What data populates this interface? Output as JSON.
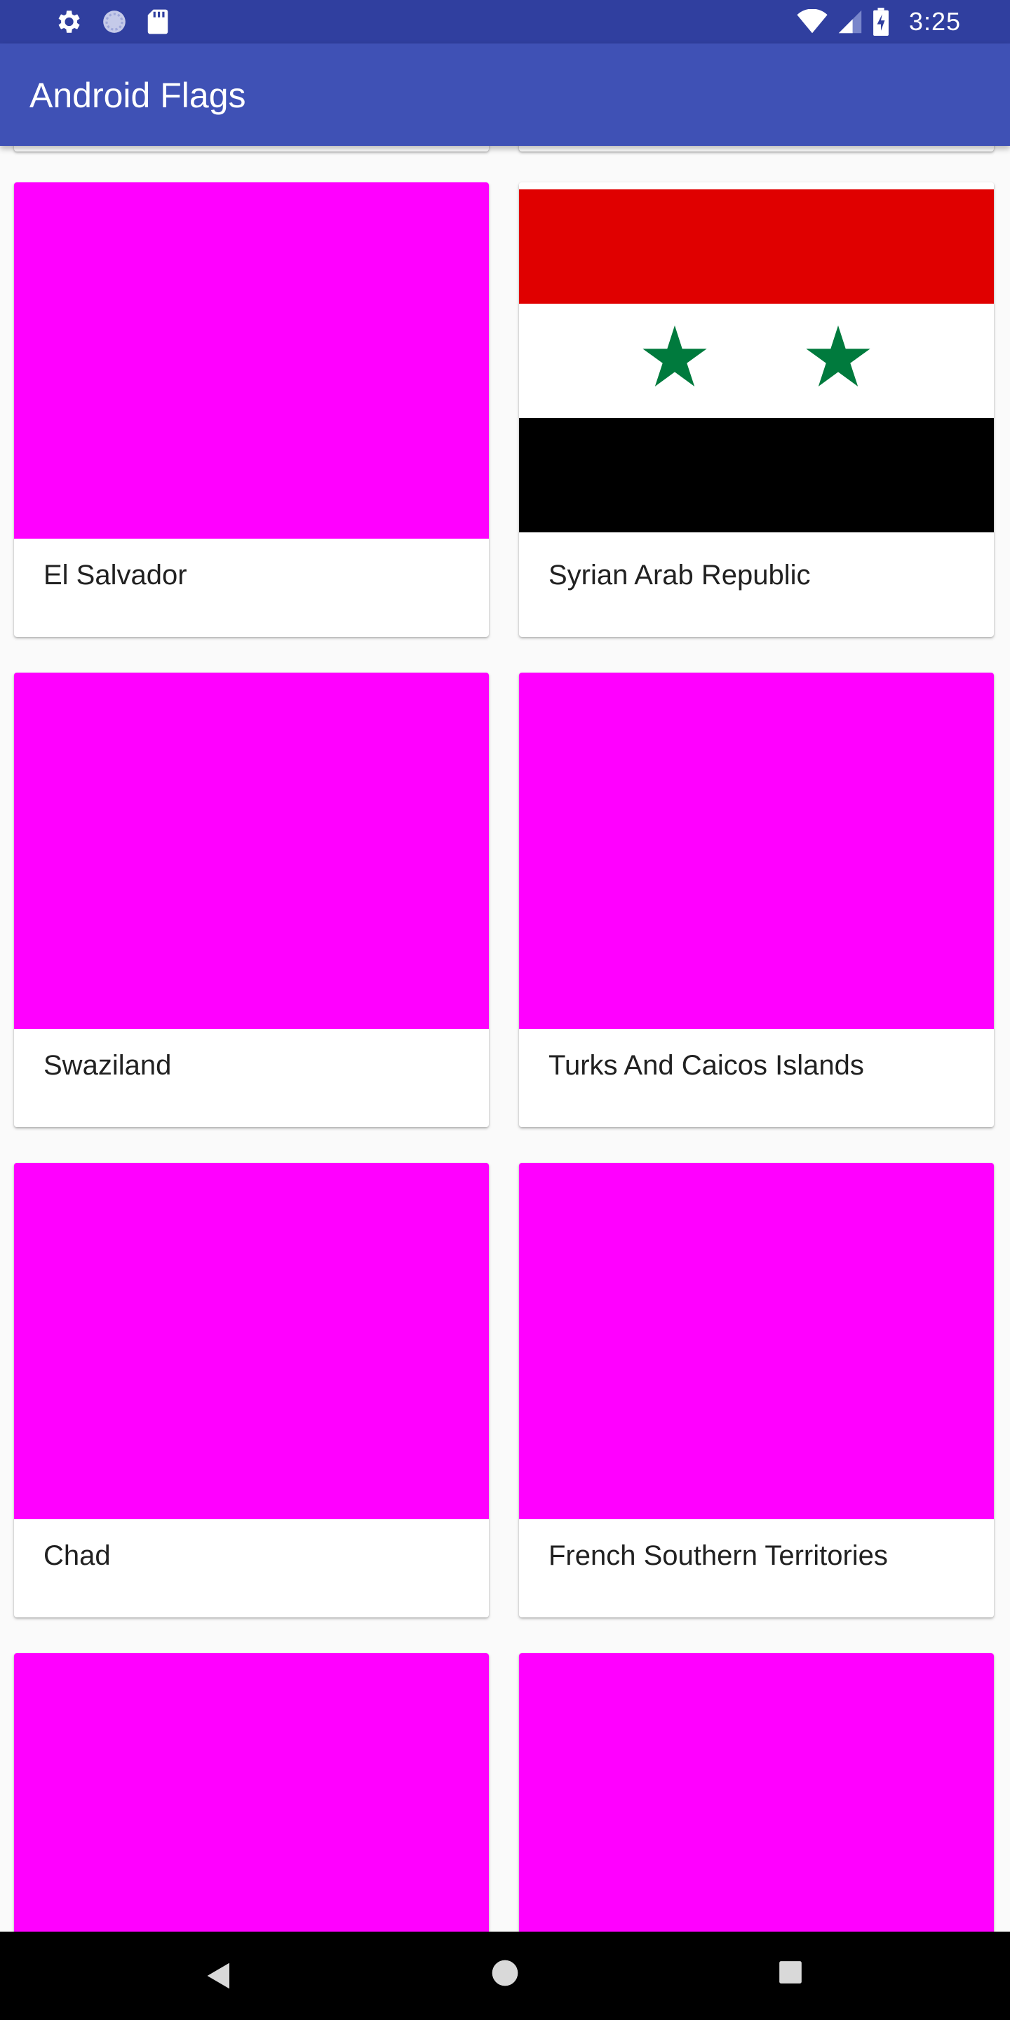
{
  "status_bar": {
    "time": "3:25",
    "left_icons": [
      "gear-icon",
      "sync-icon",
      "sd-card-icon"
    ],
    "right_icons": [
      "wifi-icon",
      "signal-icon",
      "battery-icon"
    ]
  },
  "app_bar": {
    "title": "Android Flags",
    "color": "#3f51b5",
    "status_color": "#303f9f"
  },
  "flags": [
    {
      "name": "El Salvador",
      "image": "placeholder",
      "color": "#ff00ff"
    },
    {
      "name": "Syrian Arab Republic",
      "image": "syria-flag"
    },
    {
      "name": "Swaziland",
      "image": "placeholder",
      "color": "#ff00ff"
    },
    {
      "name": "Turks And Caicos Islands",
      "image": "placeholder",
      "color": "#ff00ff"
    },
    {
      "name": "Chad",
      "image": "placeholder",
      "color": "#ff00ff"
    },
    {
      "name": "French Southern Territories",
      "image": "placeholder",
      "color": "#ff00ff"
    },
    {
      "name": "",
      "image": "placeholder",
      "color": "#ff00ff"
    },
    {
      "name": "",
      "image": "placeholder",
      "color": "#ff00ff"
    }
  ],
  "nav_bar": {
    "buttons": [
      "back-button",
      "home-button",
      "recents-button"
    ]
  }
}
